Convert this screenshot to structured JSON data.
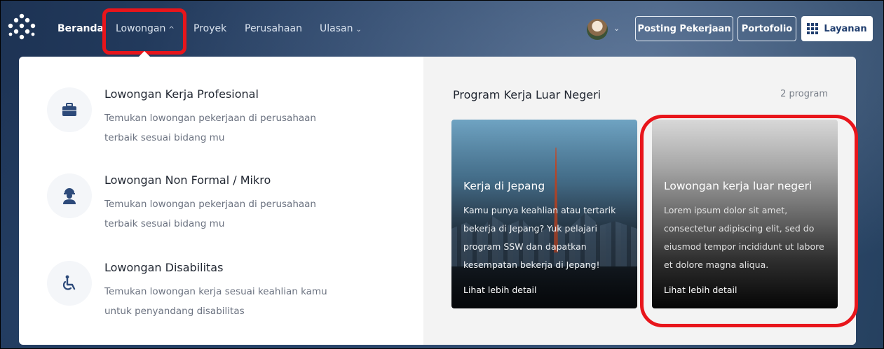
{
  "nav": {
    "items": [
      {
        "label": "Beranda",
        "active": true,
        "has_dropdown": false
      },
      {
        "label": "Lowongan",
        "active": false,
        "has_dropdown": true,
        "chevron": "^"
      },
      {
        "label": "Proyek",
        "active": false,
        "has_dropdown": false
      },
      {
        "label": "Perusahaan",
        "active": false,
        "has_dropdown": false
      },
      {
        "label": "Ulasan",
        "active": false,
        "has_dropdown": true,
        "chevron": "v"
      }
    ],
    "post_job_label": "Posting Pekerjaan",
    "portfolio_label": "Portofolio",
    "services_label": "Layanan",
    "chevron_down": "⌄",
    "chevron_up": "^"
  },
  "dropdown": {
    "menu": [
      {
        "title": "Lowongan Kerja Profesional",
        "desc": "Temukan lowongan pekerjaan di perusahaan terbaik sesuai bidang mu",
        "icon": "briefcase-icon"
      },
      {
        "title": "Lowongan Non Formal / Mikro",
        "desc": "Temukan lowongan pekerjaan di perusahaan terbaik sesuai bidang mu",
        "icon": "worker-helmet-icon"
      },
      {
        "title": "Lowongan Disabilitas",
        "desc": "Temukan lowongan kerja sesuai keahlian kamu untuk penyandang disabilitas",
        "icon": "wheelchair-icon"
      }
    ],
    "program": {
      "title": "Program Kerja Luar Negeri",
      "count": "2 program",
      "cards": [
        {
          "title": "Kerja di Jepang",
          "desc": "Kamu punya keahlian atau tertarik bekerja di Jepang? Yuk pelajari program SSW dan dapatkan kesempatan bekerja di Jepang!",
          "link": "Lihat lebih detail"
        },
        {
          "title": "Lowongan kerja luar negeri",
          "desc": "Lorem ipsum dolor sit amet, consectetur adipiscing elit, sed do eiusmod tempor incididunt ut labore et dolore magna aliqua.",
          "link": "Lihat lebih detail"
        }
      ]
    }
  },
  "colors": {
    "highlight": "#e8151b",
    "accent": "#1f3d6e",
    "icon": "#2d4a7a"
  }
}
